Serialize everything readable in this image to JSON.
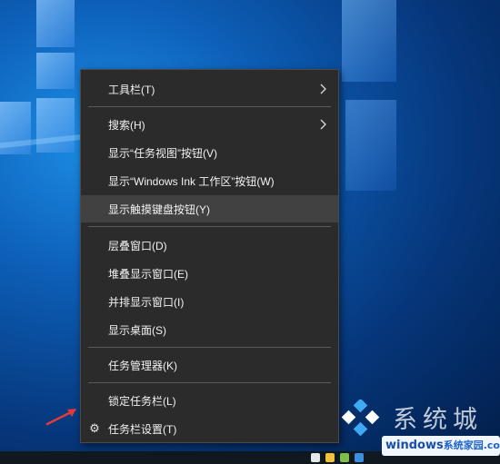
{
  "menu": {
    "items": [
      {
        "label": "工具栏(T)",
        "submenu": true
      },
      {
        "label": "搜索(H)",
        "submenu": true
      },
      {
        "label": "显示“任务视图”按钮(V)"
      },
      {
        "label": "显示“Windows Ink 工作区”按钮(W)"
      },
      {
        "label": "显示触摸键盘按钮(Y)",
        "highlighted": true
      },
      {
        "label": "层叠窗口(D)"
      },
      {
        "label": "堆叠显示窗口(E)"
      },
      {
        "label": "并排显示窗口(I)"
      },
      {
        "label": "显示桌面(S)"
      },
      {
        "label": "任务管理器(K)"
      },
      {
        "label": "锁定任务栏(L)"
      },
      {
        "label": "任务栏设置(T)",
        "icon": "gear-icon"
      }
    ]
  },
  "watermark": {
    "title": "系统城",
    "url_bold": "windows",
    "url_rest": "系统家园",
    "url_suffix": ".com"
  },
  "colors": {
    "menu_bg": "#2b2b2b",
    "menu_hover": "#414141",
    "menu_text": "#f2f2f2",
    "separator": "#5a5a5a",
    "arrow": "#e23b3b"
  }
}
